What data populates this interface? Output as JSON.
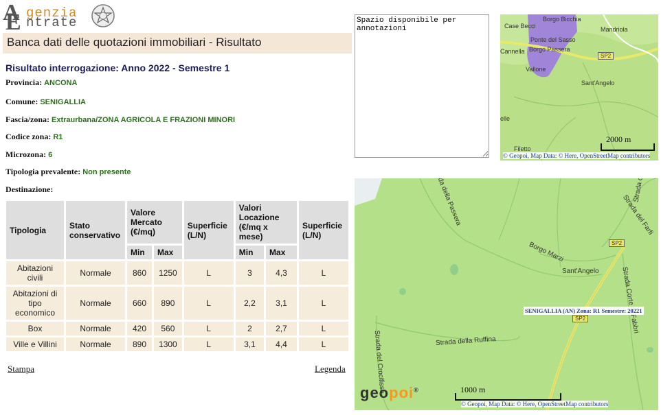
{
  "logo": {
    "line1": "genzia",
    "line2": "ntrate",
    "letter_a": "A",
    "letter_e": "E"
  },
  "banner": {
    "title": "Banca dati delle quotazioni immobiliari - Risultato"
  },
  "result": {
    "title": "Risultato interrogazione: Anno 2022 - Semestre 1",
    "fields": [
      {
        "label": "Provincia:",
        "value": "ANCONA"
      },
      {
        "label": "Comune:",
        "value": "SENIGALLIA"
      },
      {
        "label": "Fascia/zona:",
        "value": "Extraurbana/ZONA AGRICOLA E FRAZIONI MINORI"
      },
      {
        "label": "Codice zona:",
        "value": "R1"
      },
      {
        "label": "Microzona:",
        "value": "6"
      },
      {
        "label": "Tipologia prevalente:",
        "value": "Non presente"
      },
      {
        "label": "Destinazione:",
        "value": ""
      }
    ]
  },
  "table": {
    "headers": {
      "tipologia": "Tipologia",
      "stato": "Stato conservativo",
      "valore_mercato": "Valore Mercato (€/mq)",
      "superficie1": "Superficie (L/N)",
      "valori_locazione": "Valori Locazione (€/mq x mese)",
      "superficie2": "Superficie (L/N)",
      "min": "Min",
      "max": "Max"
    },
    "rows": [
      {
        "tipologia": "Abitazioni civili",
        "stato": "Normale",
        "vm_min": "860",
        "vm_max": "1250",
        "sup1": "L",
        "vl_min": "3",
        "vl_max": "4,3",
        "sup2": "L"
      },
      {
        "tipologia": "Abitazioni di tipo economico",
        "stato": "Normale",
        "vm_min": "660",
        "vm_max": "890",
        "sup1": "L",
        "vl_min": "2,2",
        "vl_max": "3,1",
        "sup2": "L"
      },
      {
        "tipologia": "Box",
        "stato": "Normale",
        "vm_min": "420",
        "vm_max": "560",
        "sup1": "L",
        "vl_min": "2",
        "vl_max": "2,7",
        "sup2": "L"
      },
      {
        "tipologia": "Ville e Villini",
        "stato": "Normale",
        "vm_min": "890",
        "vm_max": "1300",
        "sup1": "L",
        "vl_min": "3,1",
        "vl_max": "4,4",
        "sup2": "L"
      }
    ]
  },
  "links": {
    "stampa": "Stampa",
    "legenda": "Legenda"
  },
  "notes": {
    "value": "Spazio disponibile per annotazioni"
  },
  "map_small": {
    "labels": [
      "Borgo Bicchia",
      "Case Becci",
      "Mandriola",
      "Ponte del Sasso",
      "Cannella",
      "Borgo Passera",
      "Vallone",
      "Sant'Angelo",
      "elle",
      "Filetto"
    ],
    "road": "SP2",
    "scale": "2000 m",
    "attribution": "© Geopoi, Map Data: © Here, OpenStreetMap contributors"
  },
  "map_large": {
    "labels": [
      "Strada della Passera",
      "Strada del Farfi",
      "Borgo Marzi",
      "Sant'Angelo",
      "Strada Corte di Fabbri",
      "Strada della Ruffina",
      "Strada del Crocifisso",
      "Strada de"
    ],
    "roads": [
      "SP2",
      "SP2"
    ],
    "zone_label": "SENIGALLIA (AN) Zona: R1 Semestre: 20221",
    "scale": "1000 m",
    "attribution": "© Geopoi, Map Data: © Here, OpenStreetMap contributors",
    "brand_geo": "geo",
    "brand_poi": "poi",
    "brand_reg": "®"
  }
}
